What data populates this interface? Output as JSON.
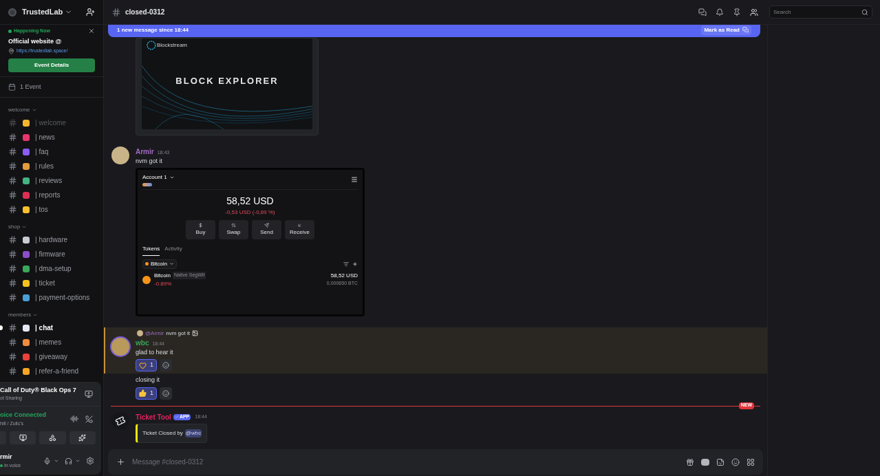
{
  "server": {
    "name": "TrustedLab"
  },
  "event": {
    "status": "Happening Now",
    "title": "Official website @",
    "link": "https://trustedlab.space/",
    "button": "Event Details"
  },
  "events_count": "1 Event",
  "categories": [
    {
      "name": "welcome",
      "channels": [
        {
          "name": "| welcome",
          "color": "#f5b62e",
          "muted": true,
          "selected": false
        },
        {
          "name": "| news",
          "color": "#e8366b",
          "muted": false,
          "selected": false
        },
        {
          "name": "| faq",
          "color": "#8a5cf6",
          "muted": false,
          "selected": false
        },
        {
          "name": "| rules",
          "color": "#e39b3d",
          "muted": false,
          "selected": false
        },
        {
          "name": "| reviews",
          "color": "#43b581",
          "muted": false,
          "selected": false
        },
        {
          "name": "| reports",
          "color": "#dd2e54",
          "muted": false,
          "selected": false
        },
        {
          "name": "| tos",
          "color": "#f9c02e",
          "muted": false,
          "selected": false
        }
      ]
    },
    {
      "name": "shop",
      "channels": [
        {
          "name": "| hardware",
          "color": "#c9cbd4",
          "muted": false,
          "selected": false
        },
        {
          "name": "| firmware",
          "color": "#8a4fc9",
          "muted": false,
          "selected": false
        },
        {
          "name": "| dma-setup",
          "color": "#39a85a",
          "muted": false,
          "selected": false
        },
        {
          "name": "| ticket",
          "color": "#f4c21b",
          "muted": false,
          "selected": false
        },
        {
          "name": "| payment-options",
          "color": "#4a9fd8",
          "muted": false,
          "selected": false
        }
      ]
    },
    {
      "name": "members",
      "channels": [
        {
          "name": "| chat",
          "color": "#e6e9f5",
          "muted": false,
          "selected": true
        },
        {
          "name": "| memes",
          "color": "#f28b3c",
          "muted": false,
          "selected": false
        },
        {
          "name": "| giveaway",
          "color": "#e8423a",
          "muted": false,
          "selected": false
        },
        {
          "name": "| refer-a-friend",
          "color": "#f5a623",
          "muted": false,
          "selected": false
        }
      ]
    }
  ],
  "panel": {
    "activity": {
      "title": "Call of Duty® Black Ops 7",
      "subtitle": "ot Sharing"
    },
    "voice": {
      "status": "oice Connected",
      "channel": "hill / Zulic's"
    },
    "user": {
      "name": "rmir",
      "status": "In voice"
    }
  },
  "header": {
    "channel": "closed-0312",
    "search_placeholder": "Search"
  },
  "banner": {
    "text": "1 new message since 18:44",
    "action": "Mark as Read"
  },
  "attachment": {
    "brand": "Blockstream",
    "title": "BLOCK EXPLORER"
  },
  "message": {
    "author": "Armir",
    "color": "#a56bc7",
    "time": "18:43",
    "text": "nvm got it"
  },
  "wallet": {
    "account": "Account 1",
    "balance": "58,52 USD",
    "change": "-0,53 USD (-0,89 %)",
    "actions": [
      {
        "kind": "buy",
        "label": "Buy"
      },
      {
        "kind": "swap",
        "label": "Swap"
      },
      {
        "kind": "send",
        "label": "Send"
      },
      {
        "kind": "receive",
        "label": "Receive"
      }
    ],
    "tabs": [
      {
        "label": "Tokens",
        "selected": true
      },
      {
        "label": "Activity",
        "selected": false
      }
    ],
    "filter": "Bitcoin",
    "token": {
      "name": "Bitcoin",
      "tag": "Native SegWit",
      "change": "-0.89%",
      "value": "58,52 USD",
      "amount": "0,000650 BTC"
    }
  },
  "reply_message": {
    "highlighted": true,
    "reply_to": {
      "author": "@Armir",
      "text": "nvm got it"
    },
    "author": "wbc",
    "color": "#3ba55c",
    "time": "18:44",
    "text": "glad to hear it",
    "reactions": [
      {
        "kind": "heart-hands",
        "count": "1",
        "selected": true
      }
    ]
  },
  "followup": {
    "text": "closing it",
    "reactions": [
      {
        "kind": "thumbs-up",
        "count": "1",
        "selected": true
      }
    ]
  },
  "new_divider": {
    "badge": "NEW"
  },
  "bot_message": {
    "author": "Ticket Tool",
    "color": "#e0245e",
    "tag": "APP",
    "time": "18:44",
    "embed": {
      "text": "Ticket Closed by",
      "mention": "@wbc"
    }
  },
  "composer": {
    "placeholder": "Message #closed-0312"
  }
}
